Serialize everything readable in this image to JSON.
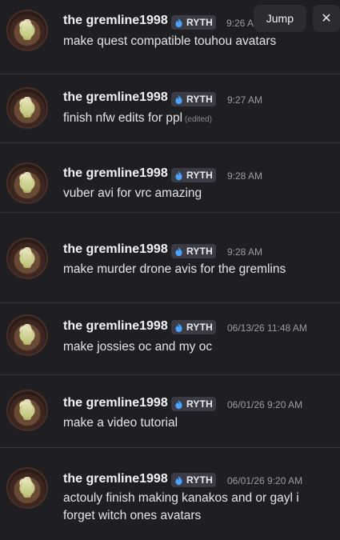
{
  "toolbar": {
    "jump_label": "Jump",
    "close_glyph": "✕"
  },
  "messages": [
    {
      "author": "the gremline1998",
      "tag": "RYTH",
      "time": "9:26 AM",
      "text": "make quest compatible  touhou avatars",
      "edited": ""
    },
    {
      "author": "the gremline1998",
      "tag": "RYTH",
      "time": "9:27 AM",
      "text": "finish nfw edits for ppl",
      "edited": "(edited)"
    },
    {
      "author": "the gremline1998",
      "tag": "RYTH",
      "time": "9:28 AM",
      "text": "vuber avi for vrc amazing",
      "edited": ""
    },
    {
      "author": "the gremline1998",
      "tag": "RYTH",
      "time": "9:28 AM",
      "text": "make murder drone avis for the gremlins",
      "edited": ""
    },
    {
      "author": "the gremline1998",
      "tag": "RYTH",
      "time": "06/13/26 11:48 AM",
      "text": "make jossies oc and my oc",
      "edited": ""
    },
    {
      "author": "the gremline1998",
      "tag": "RYTH",
      "time": "06/01/26 9:20 AM",
      "text": "make  a video tutorial",
      "edited": ""
    },
    {
      "author": "the gremline1998",
      "tag": "RYTH",
      "time": "06/01/26 9:20 AM",
      "text": "actouly finish making kanakos and or gayl i forget witch ones avatars",
      "edited": ""
    }
  ],
  "colors": {
    "background": "#1f1f23",
    "tag_bg": "#3a3b44",
    "tag_icon": "#4aa3ff"
  }
}
